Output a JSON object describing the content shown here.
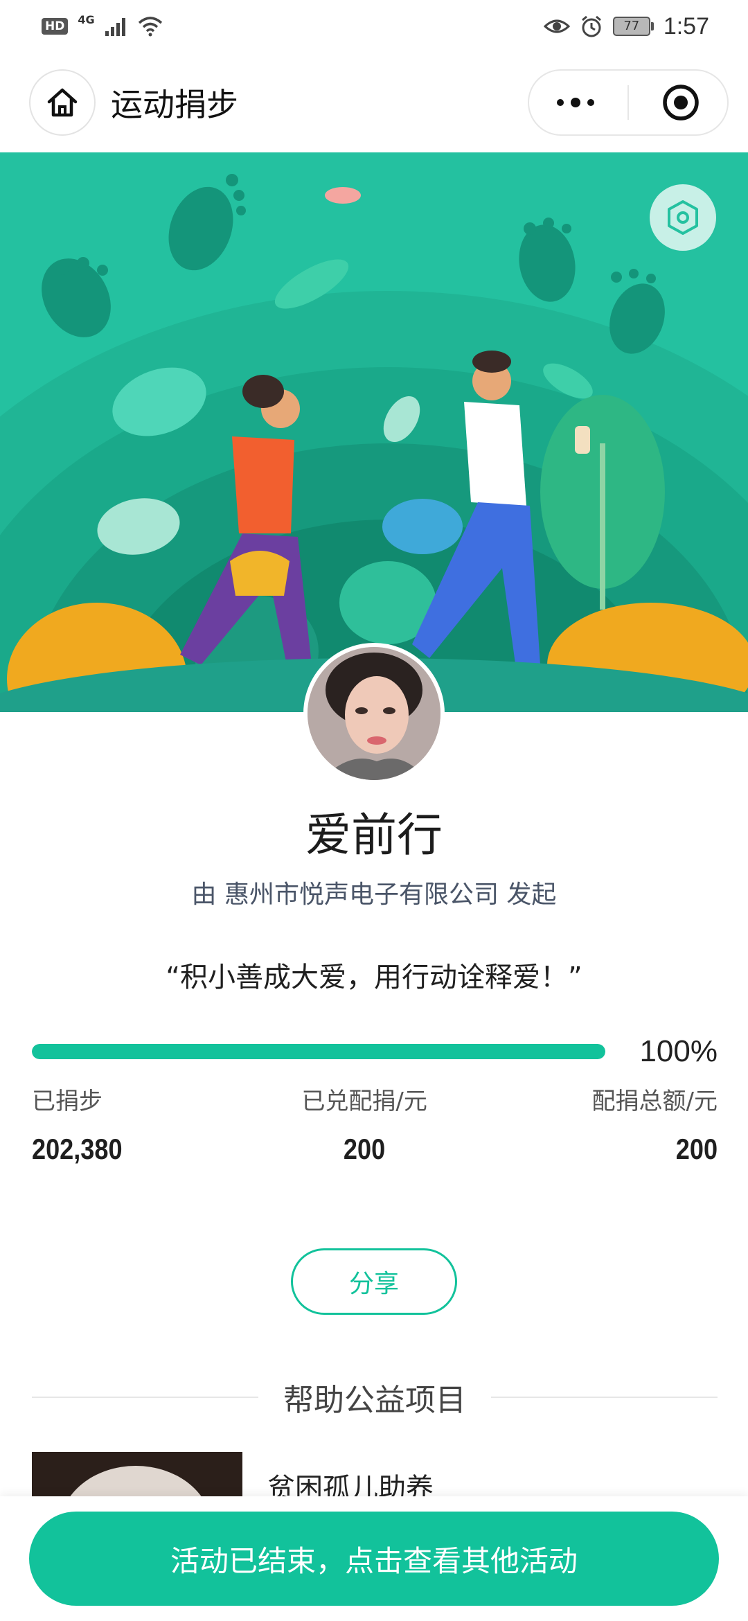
{
  "status_bar": {
    "hd": "HD",
    "network": "4G",
    "battery": "77",
    "time": "1:57"
  },
  "nav": {
    "title": "运动捐步",
    "more_icon": "more-dots-icon",
    "close_icon": "target-close-icon"
  },
  "activity": {
    "name": "爱前行",
    "organizer": "由 惠州市悦声电子有限公司 发起",
    "slogan": "“积小善成大爱，用行动诠释爱！”",
    "progress_percent": 100,
    "progress_label": "100%"
  },
  "stats": [
    {
      "label": "已捐步",
      "value": "202,380"
    },
    {
      "label": "已兑配捐/元",
      "value": "200"
    },
    {
      "label": "配捐总额/元",
      "value": "200"
    }
  ],
  "share_label": "分享",
  "section": {
    "title": "帮助公益项目"
  },
  "projects": [
    {
      "name": "贫困孤儿助养"
    }
  ],
  "cta_label": "活动已结束，点击查看其他活动",
  "colors": {
    "brand": "#12c29b",
    "banner": "#24c1a0"
  }
}
